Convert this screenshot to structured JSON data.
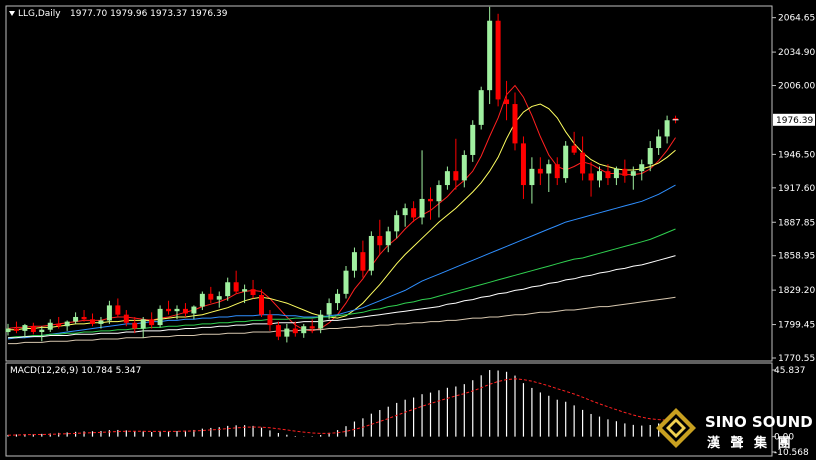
{
  "header": {
    "symbol": "LLG,Daily",
    "ohlc": "1977.70 1979.96 1973.37 1976.39"
  },
  "macd_header": "MACD(12,26,9) 10.784 5.347",
  "logo": {
    "en": "SINO SOUND",
    "cn": "漢 聲 集 團"
  },
  "colors": {
    "background": "#000000",
    "bull": "#a0f0a0",
    "bear": "#ff0000",
    "ma5": "#ff2020",
    "ma10": "#ffff60",
    "ma30": "#2f8fff",
    "ma60": "#30d050",
    "ma120": "#ffffff",
    "ma200": "#d8c8b0",
    "macd_hist": "#ffffff",
    "macd_signal": "#ff2020",
    "frame": "#c0c0c0"
  },
  "chart_data": [
    {
      "type": "candlestick",
      "title": "LLG,Daily",
      "y_ticks": [
        "2064.65",
        "2034.90",
        "2006.00",
        "1976.39",
        "1946.50",
        "1917.60",
        "1887.85",
        "1858.95",
        "1829.20",
        "1799.45",
        "1770.55"
      ],
      "ylim": [
        1770.55,
        2073
      ],
      "last_price": "1976.39",
      "ohlc": [
        [
          1793,
          1800,
          1790,
          1796
        ],
        [
          1796,
          1802,
          1792,
          1794
        ],
        [
          1794,
          1800,
          1788,
          1799
        ],
        [
          1798,
          1801,
          1791,
          1793
        ],
        [
          1793,
          1798,
          1785,
          1795
        ],
        [
          1795,
          1804,
          1793,
          1801
        ],
        [
          1800,
          1806,
          1796,
          1798
        ],
        [
          1798,
          1803,
          1794,
          1802
        ],
        [
          1802,
          1810,
          1800,
          1806
        ],
        [
          1806,
          1812,
          1802,
          1804
        ],
        [
          1804,
          1809,
          1798,
          1800
        ],
        [
          1800,
          1806,
          1796,
          1803
        ],
        [
          1803,
          1820,
          1800,
          1816
        ],
        [
          1816,
          1822,
          1806,
          1808
        ],
        [
          1808,
          1812,
          1798,
          1801
        ],
        [
          1801,
          1806,
          1792,
          1796
        ],
        [
          1796,
          1806,
          1788,
          1804
        ],
        [
          1804,
          1810,
          1796,
          1799
        ],
        [
          1799,
          1816,
          1797,
          1813
        ],
        [
          1813,
          1820,
          1808,
          1811
        ],
        [
          1811,
          1816,
          1804,
          1813
        ],
        [
          1813,
          1818,
          1806,
          1809
        ],
        [
          1809,
          1816,
          1804,
          1815
        ],
        [
          1815,
          1828,
          1812,
          1826
        ],
        [
          1826,
          1832,
          1818,
          1821
        ],
        [
          1821,
          1828,
          1814,
          1824
        ],
        [
          1824,
          1840,
          1820,
          1836
        ],
        [
          1836,
          1846,
          1826,
          1828
        ],
        [
          1828,
          1834,
          1818,
          1830
        ],
        [
          1830,
          1838,
          1822,
          1825
        ],
        [
          1825,
          1830,
          1806,
          1808
        ],
        [
          1808,
          1812,
          1794,
          1799
        ],
        [
          1799,
          1802,
          1786,
          1789
        ],
        [
          1789,
          1800,
          1784,
          1796
        ],
        [
          1796,
          1802,
          1789,
          1792
        ],
        [
          1792,
          1800,
          1788,
          1798
        ],
        [
          1798,
          1804,
          1792,
          1796
        ],
        [
          1796,
          1812,
          1792,
          1808
        ],
        [
          1808,
          1822,
          1804,
          1818
        ],
        [
          1818,
          1830,
          1812,
          1826
        ],
        [
          1826,
          1850,
          1822,
          1846
        ],
        [
          1846,
          1866,
          1840,
          1862
        ],
        [
          1862,
          1872,
          1840,
          1846
        ],
        [
          1846,
          1880,
          1842,
          1876
        ],
        [
          1876,
          1890,
          1860,
          1868
        ],
        [
          1868,
          1884,
          1862,
          1880
        ],
        [
          1880,
          1898,
          1874,
          1894
        ],
        [
          1894,
          1904,
          1884,
          1900
        ],
        [
          1900,
          1906,
          1888,
          1892
        ],
        [
          1892,
          1950,
          1886,
          1908
        ],
        [
          1908,
          1918,
          1890,
          1906
        ],
        [
          1906,
          1924,
          1892,
          1920
        ],
        [
          1920,
          1936,
          1916,
          1932
        ],
        [
          1932,
          1960,
          1916,
          1924
        ],
        [
          1924,
          1950,
          1918,
          1946
        ],
        [
          1946,
          1976,
          1940,
          1972
        ],
        [
          1972,
          2005,
          1968,
          2002
        ],
        [
          2002,
          2074,
          1990,
          2062
        ],
        [
          2062,
          2068,
          1988,
          1994
        ],
        [
          1994,
          2010,
          1976,
          1990
        ],
        [
          1990,
          2000,
          1950,
          1956
        ],
        [
          1956,
          1962,
          1908,
          1920
        ],
        [
          1920,
          1944,
          1904,
          1934
        ],
        [
          1934,
          1944,
          1920,
          1930
        ],
        [
          1930,
          1942,
          1914,
          1938
        ],
        [
          1938,
          1944,
          1920,
          1926
        ],
        [
          1926,
          1958,
          1922,
          1954
        ],
        [
          1954,
          1966,
          1946,
          1948
        ],
        [
          1948,
          1962,
          1924,
          1930
        ],
        [
          1930,
          1940,
          1910,
          1924
        ],
        [
          1924,
          1936,
          1918,
          1932
        ],
        [
          1932,
          1938,
          1920,
          1926
        ],
        [
          1926,
          1936,
          1920,
          1934
        ],
        [
          1934,
          1942,
          1922,
          1928
        ],
        [
          1928,
          1936,
          1916,
          1932
        ],
        [
          1932,
          1942,
          1924,
          1938
        ],
        [
          1938,
          1958,
          1932,
          1952
        ],
        [
          1952,
          1968,
          1946,
          1962
        ],
        [
          1962,
          1980,
          1956,
          1976
        ],
        [
          1977.7,
          1979.96,
          1973.37,
          1976.39
        ]
      ],
      "series": [
        {
          "values": [
            1796,
            1797,
            1797,
            1798,
            1798,
            1799,
            1800,
            1801,
            1802,
            1803,
            1803,
            1803,
            1805,
            1806,
            1806,
            1805,
            1804,
            1803,
            1805,
            1806,
            1808,
            1810,
            1812,
            1815,
            1817,
            1819,
            1822,
            1826,
            1828,
            1829,
            1828,
            1822,
            1814,
            1806,
            1799,
            1795,
            1794,
            1796,
            1801,
            1808,
            1818,
            1830,
            1839,
            1850,
            1860,
            1868,
            1874,
            1882,
            1889,
            1894,
            1898,
            1904,
            1910,
            1918,
            1924,
            1932,
            1945,
            1962,
            1978,
            1998,
            2006,
            1996,
            1980,
            1962,
            1946,
            1936,
            1933,
            1936,
            1940,
            1938,
            1934,
            1930,
            1930,
            1929,
            1929,
            1930,
            1934,
            1941,
            1950,
            1961
          ]
        },
        {
          "values": [
            1795,
            1795,
            1796,
            1796,
            1797,
            1797,
            1798,
            1799,
            1800,
            1800,
            1801,
            1801,
            1802,
            1802,
            1803,
            1803,
            1803,
            1803,
            1804,
            1805,
            1806,
            1806,
            1807,
            1808,
            1810,
            1812,
            1814,
            1817,
            1820,
            1822,
            1823,
            1822,
            1820,
            1818,
            1815,
            1812,
            1809,
            1807,
            1806,
            1805,
            1807,
            1812,
            1818,
            1826,
            1834,
            1843,
            1852,
            1860,
            1867,
            1874,
            1881,
            1888,
            1894,
            1900,
            1907,
            1914,
            1922,
            1932,
            1944,
            1960,
            1974,
            1983,
            1988,
            1990,
            1986,
            1978,
            1966,
            1956,
            1948,
            1942,
            1938,
            1936,
            1934,
            1933,
            1933,
            1934,
            1936,
            1939,
            1944,
            1950
          ]
        },
        {
          "values": [
            1787,
            1788,
            1788,
            1789,
            1790,
            1791,
            1792,
            1793,
            1794,
            1795,
            1796,
            1797,
            1798,
            1799,
            1800,
            1800,
            1801,
            1802,
            1802,
            1803,
            1803,
            1804,
            1804,
            1805,
            1805,
            1806,
            1806,
            1807,
            1807,
            1807,
            1808,
            1808,
            1808,
            1807,
            1807,
            1806,
            1806,
            1806,
            1807,
            1808,
            1810,
            1812,
            1814,
            1817,
            1820,
            1823,
            1826,
            1829,
            1833,
            1837,
            1840,
            1843,
            1846,
            1849,
            1852,
            1855,
            1858,
            1861,
            1864,
            1867,
            1870,
            1873,
            1876,
            1879,
            1882,
            1885,
            1888,
            1890,
            1892,
            1894,
            1896,
            1898,
            1900,
            1902,
            1904,
            1906,
            1909,
            1912,
            1916,
            1920
          ]
        },
        {
          "values": [
            1788,
            1789,
            1789,
            1790,
            1790,
            1791,
            1791,
            1792,
            1792,
            1793,
            1793,
            1794,
            1794,
            1795,
            1795,
            1796,
            1796,
            1797,
            1797,
            1798,
            1798,
            1799,
            1799,
            1800,
            1800,
            1801,
            1801,
            1802,
            1802,
            1803,
            1803,
            1804,
            1804,
            1804,
            1805,
            1805,
            1805,
            1806,
            1806,
            1807,
            1808,
            1809,
            1810,
            1812,
            1813,
            1815,
            1816,
            1818,
            1819,
            1821,
            1822,
            1824,
            1826,
            1828,
            1830,
            1832,
            1834,
            1836,
            1838,
            1840,
            1842,
            1844,
            1846,
            1848,
            1850,
            1852,
            1854,
            1856,
            1857,
            1859,
            1861,
            1863,
            1865,
            1867,
            1869,
            1871,
            1873,
            1876,
            1879,
            1882
          ]
        },
        {
          "values": [
            1788,
            1788,
            1789,
            1789,
            1789,
            1790,
            1790,
            1790,
            1791,
            1791,
            1791,
            1792,
            1792,
            1792,
            1793,
            1793,
            1794,
            1794,
            1794,
            1795,
            1795,
            1796,
            1796,
            1797,
            1797,
            1798,
            1798,
            1799,
            1799,
            1800,
            1800,
            1800,
            1801,
            1801,
            1801,
            1802,
            1802,
            1802,
            1803,
            1803,
            1804,
            1805,
            1806,
            1807,
            1808,
            1809,
            1810,
            1811,
            1812,
            1813,
            1814,
            1815,
            1817,
            1818,
            1820,
            1821,
            1823,
            1824,
            1826,
            1827,
            1829,
            1830,
            1832,
            1833,
            1835,
            1836,
            1838,
            1839,
            1841,
            1842,
            1844,
            1845,
            1847,
            1848,
            1850,
            1851,
            1853,
            1855,
            1857,
            1859
          ]
        },
        {
          "values": [
            1783,
            1783,
            1784,
            1784,
            1784,
            1785,
            1785,
            1785,
            1786,
            1786,
            1786,
            1787,
            1787,
            1787,
            1788,
            1788,
            1788,
            1789,
            1789,
            1789,
            1790,
            1790,
            1790,
            1791,
            1791,
            1791,
            1792,
            1792,
            1792,
            1793,
            1793,
            1793,
            1794,
            1794,
            1794,
            1795,
            1795,
            1795,
            1796,
            1796,
            1797,
            1797,
            1798,
            1798,
            1799,
            1799,
            1800,
            1800,
            1801,
            1801,
            1802,
            1802,
            1803,
            1803,
            1804,
            1805,
            1805,
            1806,
            1806,
            1807,
            1808,
            1808,
            1809,
            1810,
            1810,
            1811,
            1812,
            1812,
            1813,
            1814,
            1815,
            1815,
            1816,
            1817,
            1818,
            1819,
            1820,
            1821,
            1822,
            1823
          ]
        }
      ]
    },
    {
      "type": "bar",
      "title": "MACD(12,26,9) 10.784 5.347",
      "y_ticks": [
        "45.837",
        "0.00",
        "-10.568"
      ],
      "ylim": [
        -10.568,
        45.837
      ],
      "zero_tick_label": "0.00",
      "series": [
        {
          "values": [
            1.2,
            1.5,
            1.7,
            1.8,
            1.9,
            2.2,
            2.6,
            2.9,
            3.3,
            3.6,
            3.7,
            3.9,
            4.5,
            4.6,
            4.3,
            3.8,
            3.6,
            3.2,
            3.4,
            3.6,
            3.9,
            4.1,
            4.6,
            5.5,
            6.0,
            6.5,
            7.4,
            7.8,
            7.9,
            7.4,
            6.2,
            4.3,
            2.5,
            1.3,
            0.4,
            0.2,
            0.3,
            1.1,
            2.6,
            4.5,
            7.2,
            10.4,
            12.6,
            15.8,
            18.3,
            20.6,
            23.2,
            25.4,
            26.9,
            29.2,
            30.3,
            31.9,
            33.6,
            34.5,
            36.1,
            38.8,
            42.2,
            45.8,
            45.5,
            44.6,
            42.0,
            36.8,
            33.5,
            30.4,
            28.1,
            25.4,
            24.0,
            21.5,
            18.4,
            15.6,
            13.8,
            11.9,
            10.6,
            9.1,
            8.1,
            7.6,
            8.0,
            9.1,
            10.2,
            10.8
          ]
        },
        {
          "values": [
            1.0,
            1.1,
            1.3,
            1.4,
            1.5,
            1.6,
            1.8,
            2.0,
            2.2,
            2.5,
            2.7,
            2.9,
            3.2,
            3.5,
            3.7,
            3.7,
            3.7,
            3.6,
            3.6,
            3.6,
            3.7,
            3.8,
            3.9,
            4.2,
            4.6,
            5.0,
            5.5,
            6.0,
            6.4,
            6.6,
            6.5,
            6.1,
            5.4,
            4.6,
            3.8,
            3.1,
            2.5,
            2.2,
            2.3,
            2.7,
            3.6,
            5.0,
            6.5,
            8.4,
            10.4,
            12.4,
            14.6,
            16.8,
            18.8,
            20.9,
            22.8,
            24.6,
            26.4,
            28.0,
            29.6,
            31.4,
            33.6,
            36.0,
            37.9,
            39.2,
            39.8,
            39.2,
            38.1,
            36.6,
            34.9,
            33.0,
            31.2,
            29.3,
            27.1,
            24.8,
            22.6,
            20.5,
            18.5,
            16.6,
            14.9,
            13.4,
            12.3,
            11.7,
            11.4,
            11.3
          ]
        }
      ]
    }
  ]
}
